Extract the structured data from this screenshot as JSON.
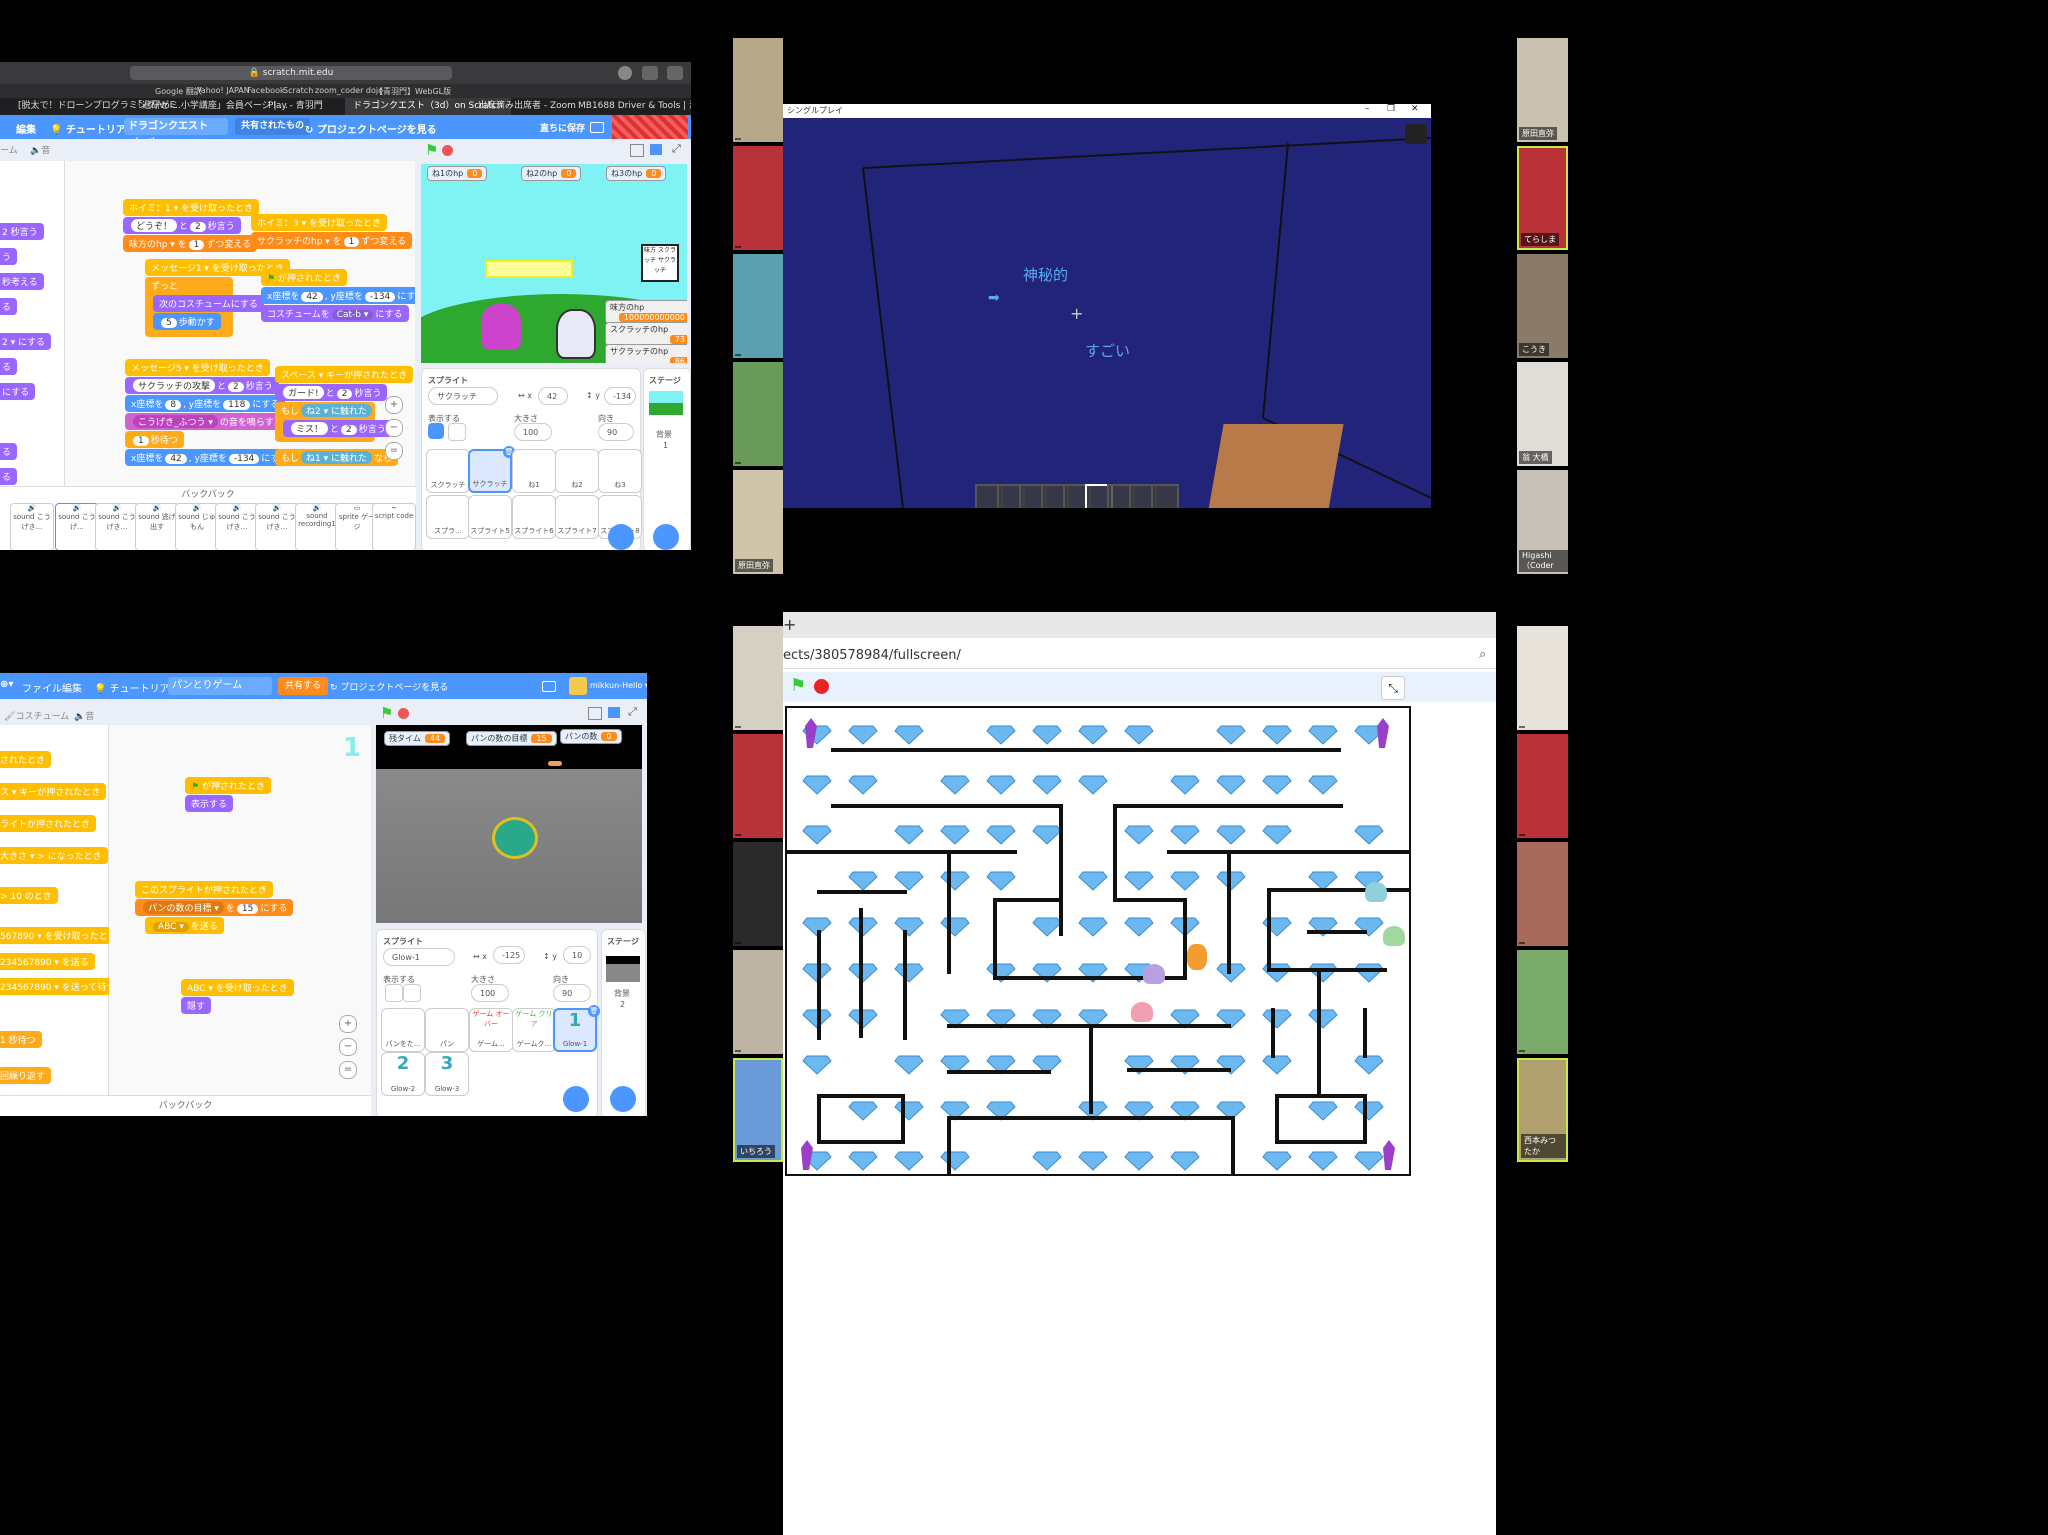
{
  "q1": {
    "url": "scratch.mit.edu",
    "bookmarks": [
      "Google 翻訳",
      "Yahoo! JAPAN",
      "Facebook",
      "Scratch",
      "zoom_coder dojo",
      "【青羽門】WebGL版"
    ],
    "tabs": [
      "[脱太で！ドローンプログラミング/Vol...",
      "「避研ゼミ 小学講座」会員ページ | ...",
      "Play - 青羽門",
      "ドラゴンクエスト（3d）on Scratch",
      "出席済み出席者 - Zoom",
      "MB1688 Driver & Tools | 液晶デ..."
    ],
    "menu": {
      "edit": "編集",
      "tutorial": "チュートリアル",
      "project_title": "ドラゴンクエスト（3d）",
      "shared": "共有されたもの",
      "project_page": "プロジェクトページを見る",
      "save": "直ちに保存"
    },
    "subtabs": [
      "ーム",
      "音"
    ],
    "blocks": {
      "b1_hat": "ホイミ：1 ▾ を受け取ったとき",
      "b1_say_a": "どうぞ！",
      "b1_say_n": "2",
      "b1_say_c": "秒言う",
      "b1_var": "味方のhp ▾",
      "b1_var_n": "1",
      "b1_var_c": "ずつ変える",
      "b2_hat": "ホイミ：3 ▾ を受け取ったとき",
      "b2_var": "サクラッチのhp ▾",
      "b2_var_n": "1",
      "b2_var_c": "ずつ変える",
      "b3_hat": "メッセージ1 ▾ を受け取ったとき",
      "b3_forever": "ずっと",
      "b3_next": "次のコスチュームにする",
      "b3_move_n": "5",
      "b3_move": "歩動かす",
      "b4_hat": "が押されたとき",
      "b4_goto": "x座標を",
      "b4_x": "42",
      "b4_y_l": "y座標を",
      "b4_y": "-134",
      "b4_set": "にする",
      "b4_costume": "コスチュームを",
      "b4_costume_v": "Cat-b ▾",
      "b4_costume_c": "にする",
      "b5_hat": "メッセージ5 ▾ を受け取ったとき",
      "b5_say": "サクラッチの攻撃",
      "b5_say_n": "2",
      "b5_say_c": "秒言う",
      "b5_goto": "x座標を",
      "b5_x": "8",
      "b5_y_l": "y座標を",
      "b5_y": "118",
      "b5_set": "にする",
      "b5_sound": "こうげき_ふつう ▾",
      "b5_sound_c": "の音を鳴らす",
      "b5_wait": "1",
      "b5_wait_c": "秒待つ",
      "b5_goto2": "x座標を",
      "b5_x2": "42",
      "b5_y2_l": "y座標を",
      "b5_y2": "-134",
      "b5_set2": "にする",
      "b6_hat": "スペース ▾ キーが押されたとき",
      "b6_say": "ガード!",
      "b6_say_n": "2",
      "b6_say_c": "秒言う",
      "b6_if": "もし",
      "b6_touch": "ね2 ▾",
      "b6_touch_c": "に触れた",
      "b6_then": "なら",
      "b6_say2": "ミス！",
      "b6_say2_n": "2",
      "b6_say2_c": "秒言う",
      "b6_if2": "もし",
      "b6_touch2": "ね1 ▾",
      "b6_touch2_c": "に触れた",
      "b6_then2": "なら"
    },
    "left_palette": [
      "2 秒言う",
      "う",
      "秒考える",
      "る",
      "2 ▾ にする",
      "る",
      "にする",
      "る",
      "る"
    ],
    "monitors": [
      {
        "label": "ね1のhp",
        "value": "0"
      },
      {
        "label": "ね2のhp",
        "value": "0"
      },
      {
        "label": "ね3のhp",
        "value": "0"
      }
    ],
    "stage_monitors": [
      {
        "label": "味方のhp",
        "value": "100000000000"
      },
      {
        "label": "スクラッチのhp",
        "value": "73"
      },
      {
        "label": "サクラッチのhp",
        "value": "86"
      }
    ],
    "stage_sign": "味方 スクラッチ サクラッチ",
    "sprite_panel": {
      "title": "スプライト",
      "name": "サクラッチ",
      "x_label": "x",
      "x": "42",
      "y_label": "y",
      "y": "-134",
      "show": "表示する",
      "size_label": "大きさ",
      "size": "100",
      "dir_label": "向き",
      "dir": "90",
      "stage": "ステージ",
      "backdrop": "背景",
      "backdrop_n": "1"
    },
    "sprites": [
      "スクラッチ",
      "サクラッチ",
      "ね1",
      "ね2",
      "ね3",
      "スプラ...",
      "スプライト5",
      "スプライト6",
      "スプライト7",
      "スプライト8"
    ],
    "backpack": "バックパック",
    "backpack_items": [
      "sound こうげき...",
      "sound こうげ...",
      "sound こうげき...",
      "sound 逃げ出す",
      "sound じゅもん",
      "sound こうげき...",
      "sound こうげき...",
      "sound recording1",
      "sprite ゲージ",
      "script code"
    ]
  },
  "q2": {
    "window_title": "シングルプレイ",
    "text1": "神秘的",
    "text2": "すごい"
  },
  "q3": {
    "menu": {
      "file": "ファイル",
      "edit": "編集",
      "tutorial": "チュートリアル",
      "project_title": "パンとりゲーム",
      "share": "共有する",
      "project_page": "プロジェクトページを見る",
      "user": "mikkun-Hello"
    },
    "subtabs": [
      "コスチューム",
      "音"
    ],
    "palette": [
      "されたとき",
      "ス ▾ キーが押されたとき",
      "ライトが押されたとき",
      "大きさ ▾ > になったとき",
      "> 10 のとき",
      "567890 ▾ を受け取ったとき",
      "234567890 ▾ を送る",
      "234567890 ▾ を送って待つ",
      "1 秒待つ",
      "回繰り返す"
    ],
    "blocks": {
      "b1_hat": "が押されたとき",
      "b1_show": "表示する",
      "b2_hat": "このスプライトが押されたとき",
      "b2_var": "パンの数の目標 ▾",
      "b2_var_mid": "を",
      "b2_var_n": "15",
      "b2_var_c": "にする",
      "b2_send": "ABC ▾",
      "b2_send_c": "を送る",
      "b3_hat": "ABC ▾ を受け取ったとき",
      "b3_hide": "隠す"
    },
    "monitors": [
      {
        "label": "残タイム",
        "value": "44"
      },
      {
        "label": "パンの数の目標",
        "value": "15"
      },
      {
        "label": "パンの数",
        "value": "0"
      }
    ],
    "sprite_panel": {
      "title": "スプライト",
      "name": "Glow-1",
      "x_label": "x",
      "x": "-125",
      "y_label": "y",
      "y": "10",
      "show": "表示する",
      "size_label": "大きさ",
      "size": "100",
      "dir_label": "向き",
      "dir": "90",
      "stage": "ステージ",
      "backdrop": "背景",
      "backdrop_n": "2"
    },
    "sprites": [
      "パンをた...",
      "パン",
      "ゲーム...",
      "ゲームク...",
      "Glow-1",
      "Glow-2",
      "Glow-3"
    ],
    "sprite_glyphs": [
      "",
      "",
      "ゲーム オーバー",
      "ゲーム クリア",
      "1",
      "2",
      "3"
    ],
    "backpack": "バックパック",
    "number_label": "1"
  },
  "q4": {
    "url": "ects/380578984/fullscreen/"
  },
  "participants": {
    "left_top": [
      "",
      "",
      "",
      "",
      "原田直弥"
    ],
    "right_top": [
      "原田直弥",
      "てらしま",
      "こうき",
      "翁 大橋",
      "Higashi（Coder"
    ],
    "left_bottom": [
      "",
      "",
      "",
      "",
      "いちろう"
    ],
    "right_bottom": [
      "",
      "",
      "",
      "",
      "西本みつたか"
    ]
  }
}
